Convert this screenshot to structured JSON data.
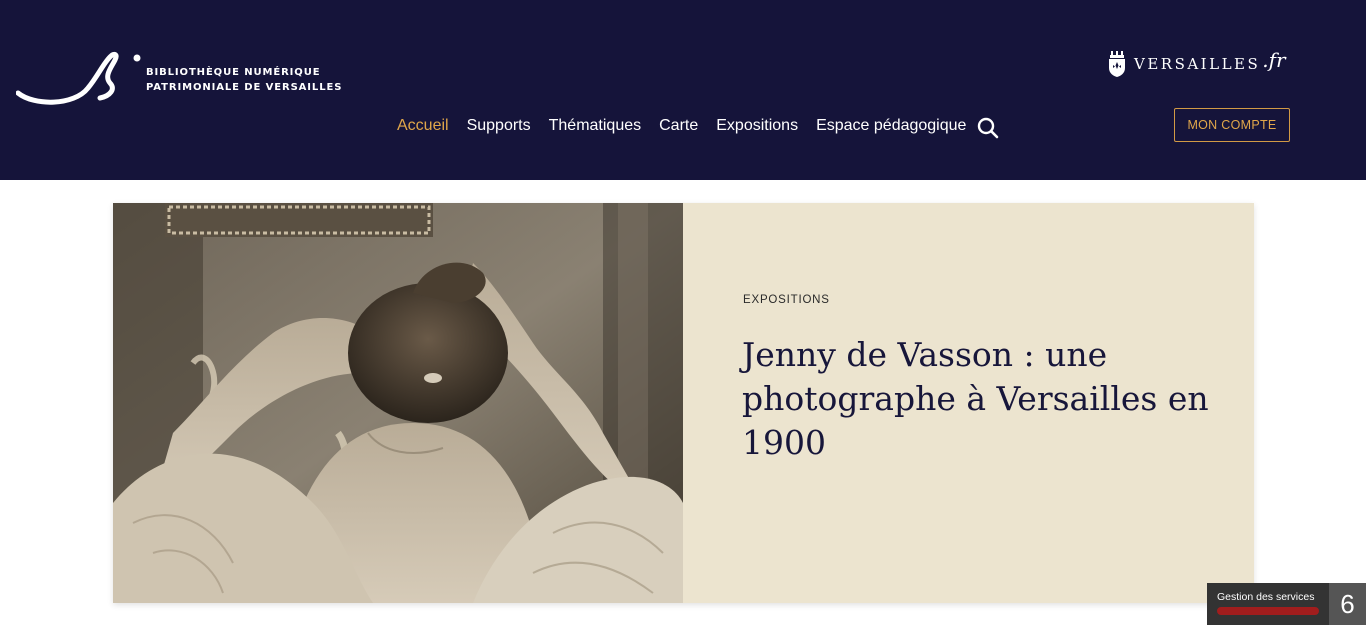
{
  "header": {
    "logo": {
      "line1": "BIBLIOTHÈQUE NUMÉRIQUE",
      "line2": "PATRIMONIALE DE VERSAILLES"
    },
    "partner_logo": {
      "name": "VERSAILLES",
      "suffix": ".fr"
    },
    "nav": [
      {
        "label": "Accueil",
        "active": true
      },
      {
        "label": "Supports"
      },
      {
        "label": "Thématiques"
      },
      {
        "label": "Carte"
      },
      {
        "label": "Expositions"
      },
      {
        "label": "Espace pédagogique"
      }
    ],
    "search_icon": "search-icon",
    "account_button": "MON COMPTE"
  },
  "hero": {
    "eyebrow": "EXPOSITIONS",
    "title": "Jenny de Vasson : une photographe à Versailles en 1900"
  },
  "cookie_widget": {
    "label": "Gestion des services",
    "count": "6"
  },
  "colors": {
    "header_bg": "#15143a",
    "accent": "#e0a64a",
    "hero_panel": "#ece4cf",
    "title": "#17163a"
  }
}
